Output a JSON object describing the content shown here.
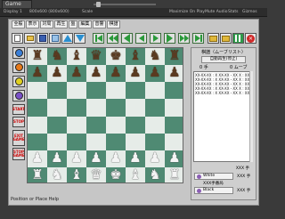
{
  "editor": {
    "tab_title": "Game",
    "display": "Display 1",
    "resolution": "800x600 (800x600)",
    "scale_label": "Scale",
    "maximize": "Maximize On Play",
    "mute": "Mute Audio",
    "stats": "Stats",
    "gizmos": "Gizmos"
  },
  "menu": {
    "items": [
      "全般",
      "表示",
      "対局",
      "再生",
      "盤",
      "編集",
      "音響",
      "棋譜"
    ]
  },
  "toolbar": {
    "buttons": [
      "new-icon",
      "open-icon",
      "save-icon",
      "up-icon",
      "down-icon",
      "first-icon",
      "prev-many-icon",
      "prev-icon",
      "play-icon",
      "next-icon",
      "next-many-icon",
      "last-icon",
      "folder-icon",
      "folder-alt-icon",
      "grid-icon",
      "stop-icon"
    ]
  },
  "side_tools": {
    "buttons": [
      "rotate-icon",
      "clock-icon",
      "stop-circle-icon",
      "circle-icon"
    ],
    "text_buttons": [
      "START",
      "STOP",
      "EXIT",
      "GAME",
      "STOP",
      "GAME"
    ]
  },
  "board": {
    "light_color": "#e6ece8",
    "dark_color": "#4f8a73",
    "pieces": {
      "dark_back": [
        "♜",
        "♞",
        "♝",
        "♛",
        "♚",
        "♝",
        "♞",
        "♜"
      ],
      "dark_pawn": "♟",
      "light_back": [
        "♜",
        "♞",
        "♝",
        "♛",
        "♚",
        "♝",
        "♞",
        "♜"
      ],
      "light_pawn": "♟"
    }
  },
  "panel": {
    "title": "棋譜（ムーブリスト）",
    "auto_button": "自動再生(停止)",
    "turn_count": "0 手",
    "move_count": "0 ムーブ",
    "moves": [
      "XX-XX-XX : X XX-XX - XX X : XX-XX",
      "XX-XX-XX : X XX-XX - XX X : XX-XX",
      "XX-XX-XX : X XX-XX - XX X : XX-XX",
      "XX-XX-XX : X XX-XX - XX X : XX-XX",
      "XX-XX-XX : X XX-XX - XX X : XX-XX"
    ],
    "score_label": "XXX",
    "score_unit": "手",
    "players": [
      {
        "name": "White",
        "value": "XXX",
        "unit": "手"
      },
      {
        "name": "XXX手番局",
        "value": "",
        "unit": ""
      },
      {
        "name": "Black",
        "value": "XXX",
        "unit": "手"
      }
    ]
  },
  "status": {
    "text": "Position or Place Help"
  }
}
